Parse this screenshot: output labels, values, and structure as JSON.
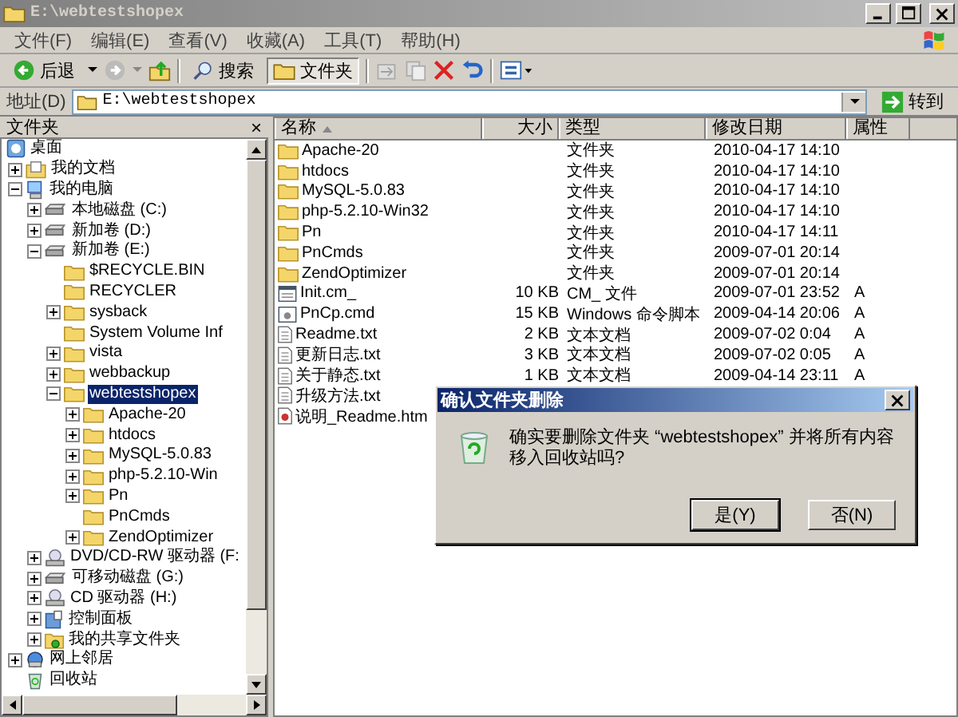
{
  "window": {
    "title": "E:\\webtestshopex"
  },
  "menu": [
    "文件(F)",
    "编辑(E)",
    "查看(V)",
    "收藏(A)",
    "工具(T)",
    "帮助(H)"
  ],
  "toolbar": {
    "back": "后退",
    "search": "搜索",
    "folders": {
      "label": "文件夹",
      "selected": true
    }
  },
  "address": {
    "label": "地址(D)",
    "value": "E:\\webtestshopex",
    "go": "转到"
  },
  "folders_pane": {
    "title": "文件夹",
    "close": "×",
    "tree": [
      {
        "label": "桌面",
        "kind": "desktop",
        "selected": false,
        "children": [
          {
            "label": "我的文档",
            "kind": "documents",
            "expanded": false,
            "selected": false
          },
          {
            "label": "我的电脑",
            "kind": "computer",
            "expanded": true,
            "selected": false,
            "children": [
              {
                "label": "本地磁盘 (C:)",
                "kind": "drive",
                "expanded": false,
                "selected": false
              },
              {
                "label": "新加卷 (D:)",
                "kind": "drive",
                "expanded": false,
                "selected": false
              },
              {
                "label": "新加卷 (E:)",
                "kind": "drive",
                "expanded": true,
                "selected": false,
                "children": [
                  {
                    "label": "$RECYCLE.BIN",
                    "kind": "folder",
                    "selected": false
                  },
                  {
                    "label": "RECYCLER",
                    "kind": "folder",
                    "selected": false
                  },
                  {
                    "label": "sysback",
                    "kind": "folder",
                    "expanded": false,
                    "selected": false
                  },
                  {
                    "label": "System Volume Inf",
                    "kind": "folder",
                    "selected": false
                  },
                  {
                    "label": "vista",
                    "kind": "folder",
                    "expanded": false,
                    "selected": false
                  },
                  {
                    "label": "webbackup",
                    "kind": "folder",
                    "expanded": false,
                    "selected": false
                  },
                  {
                    "label": "webtestshopex",
                    "kind": "folder",
                    "expanded": true,
                    "selected": true,
                    "children": [
                      {
                        "label": "Apache-20",
                        "kind": "folder",
                        "expanded": false,
                        "selected": false
                      },
                      {
                        "label": "htdocs",
                        "kind": "folder",
                        "expanded": false,
                        "selected": false
                      },
                      {
                        "label": "MySQL-5.0.83",
                        "kind": "folder",
                        "expanded": false,
                        "selected": false
                      },
                      {
                        "label": "php-5.2.10-Win",
                        "kind": "folder",
                        "expanded": false,
                        "selected": false
                      },
                      {
                        "label": "Pn",
                        "kind": "folder",
                        "expanded": false,
                        "selected": false
                      },
                      {
                        "label": "PnCmds",
                        "kind": "folder",
                        "selected": false
                      },
                      {
                        "label": "ZendOptimizer",
                        "kind": "folder",
                        "expanded": false,
                        "selected": false
                      }
                    ]
                  }
                ]
              },
              {
                "label": "DVD/CD-RW 驱动器 (F:",
                "kind": "cdrom",
                "expanded": false,
                "selected": false
              },
              {
                "label": "可移动磁盘 (G:)",
                "kind": "drive",
                "expanded": false,
                "selected": false
              },
              {
                "label": "CD 驱动器 (H:)",
                "kind": "cdrom",
                "expanded": false,
                "selected": false
              },
              {
                "label": "控制面板",
                "kind": "control",
                "expanded": false,
                "selected": false
              },
              {
                "label": "我的共享文件夹",
                "kind": "shared",
                "expanded": false,
                "selected": false
              }
            ]
          },
          {
            "label": "网上邻居",
            "kind": "network",
            "expanded": false,
            "selected": false
          },
          {
            "label": "回收站",
            "kind": "recycle",
            "selected": false
          }
        ]
      }
    ]
  },
  "file_list": {
    "columns": [
      "名称",
      "大小",
      "类型",
      "修改日期",
      "属性"
    ],
    "rows": [
      {
        "kind": "folder",
        "name": "Apache-20",
        "type": "文件夹",
        "modified": "2010-04-17 14:10"
      },
      {
        "kind": "folder",
        "name": "htdocs",
        "type": "文件夹",
        "modified": "2010-04-17 14:10"
      },
      {
        "kind": "folder",
        "name": "MySQL-5.0.83",
        "type": "文件夹",
        "modified": "2010-04-17 14:10"
      },
      {
        "kind": "folder",
        "name": "php-5.2.10-Win32",
        "type": "文件夹",
        "modified": "2010-04-17 14:10"
      },
      {
        "kind": "folder",
        "name": "Pn",
        "type": "文件夹",
        "modified": "2010-04-17 14:11"
      },
      {
        "kind": "folder",
        "name": "PnCmds",
        "type": "文件夹",
        "modified": "2009-07-01 20:14"
      },
      {
        "kind": "folder",
        "name": "ZendOptimizer",
        "type": "文件夹",
        "modified": "2009-07-01 20:14"
      },
      {
        "kind": "cm",
        "name": "Init.cm_",
        "size": "10 KB",
        "type": "CM_ 文件",
        "modified": "2009-07-01 23:52",
        "attr": "A"
      },
      {
        "kind": "cmd",
        "name": "PnCp.cmd",
        "size": "15 KB",
        "type": "Windows 命令脚本",
        "modified": "2009-04-14 20:06",
        "attr": "A"
      },
      {
        "kind": "txt",
        "name": "Readme.txt",
        "size": "2 KB",
        "type": "文本文档",
        "modified": "2009-07-02 0:04",
        "attr": "A"
      },
      {
        "kind": "txt",
        "name": "更新日志.txt",
        "size": "3 KB",
        "type": "文本文档",
        "modified": "2009-07-02 0:05",
        "attr": "A"
      },
      {
        "kind": "txt",
        "name": "关于静态.txt",
        "size": "1 KB",
        "type": "文本文档",
        "modified": "2009-04-14 23:11",
        "attr": "A"
      },
      {
        "kind": "txt",
        "name": "升级方法.txt"
      },
      {
        "kind": "htm",
        "name": "说明_Readme.htm"
      }
    ]
  },
  "dialog": {
    "title": "确认文件夹删除",
    "message": "确实要删除文件夹 “webtestshopex” 并将所有内容移入回收站吗?",
    "buttons": [
      {
        "label": "是(Y)",
        "selected": true
      },
      {
        "label": "否(N)",
        "selected": false
      }
    ]
  }
}
